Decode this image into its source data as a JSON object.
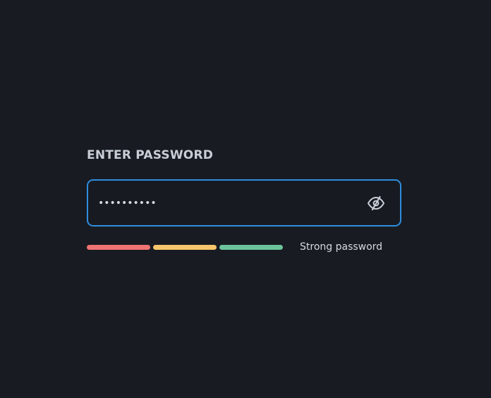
{
  "form": {
    "label": "ENTER PASSWORD",
    "password_value": "••••••••••",
    "strength_label": "Strong password"
  },
  "icons": {
    "visibility_toggle": "eye-off-icon"
  },
  "strength": {
    "level": 3,
    "max": 3,
    "segment_colors": [
      "#f07373",
      "#f7c56b",
      "#6cc49c"
    ]
  },
  "colors": {
    "background": "#181c22",
    "accent": "#2f8de0",
    "text": "#d6dae0"
  }
}
